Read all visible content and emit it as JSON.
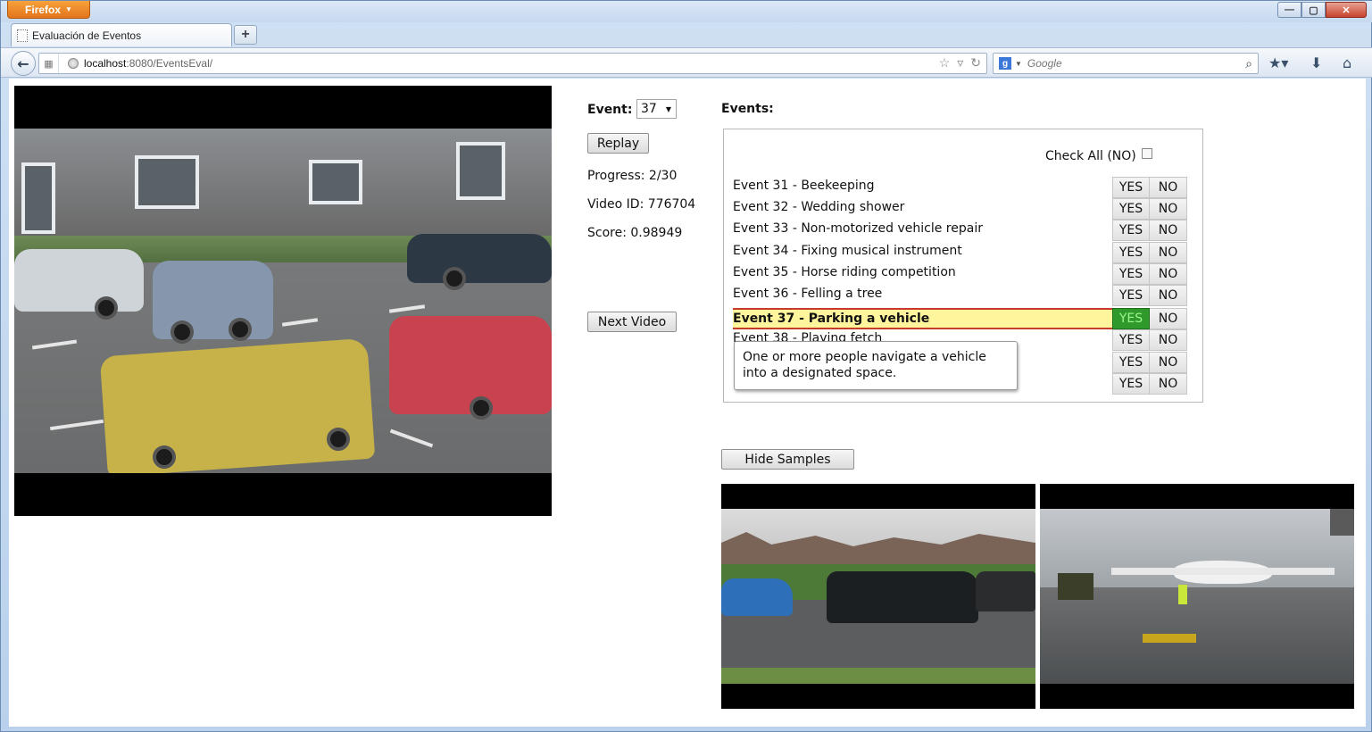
{
  "browser": {
    "menu_label": "Firefox",
    "tab_title": "Evaluación de Eventos",
    "url_host": "localhost",
    "url_rest": ":8080/EventsEval/",
    "search_placeholder": "Google",
    "window_controls": [
      "minimize-icon",
      "maximize-icon",
      "close-icon"
    ]
  },
  "controls": {
    "event_label": "Event:",
    "event_selected": "37",
    "replay_label": "Replay",
    "progress": "Progress: 2/30",
    "video_id": "Video ID: 776704",
    "score": "Score: 0.98949",
    "next_label": "Next Video",
    "hide_samples_label": "Hide Samples"
  },
  "events_panel": {
    "title": "Events:",
    "check_all_label": "Check All (NO)",
    "yes_label": "YES",
    "no_label": "NO",
    "items": [
      {
        "label": "Event 31 - Beekeeping",
        "selected": ""
      },
      {
        "label": "Event 32 - Wedding shower",
        "selected": ""
      },
      {
        "label": "Event 33 - Non-motorized vehicle repair",
        "selected": ""
      },
      {
        "label": "Event 34 - Fixing musical instrument",
        "selected": ""
      },
      {
        "label": "Event 35 - Horse riding competition",
        "selected": ""
      },
      {
        "label": "Event 36 - Felling a tree",
        "selected": ""
      },
      {
        "label": "Event 37 - Parking a vehicle",
        "selected": "YES"
      },
      {
        "label": "Event 38 - Playing fetch",
        "selected": ""
      },
      {
        "label": "",
        "selected": ""
      },
      {
        "label": "",
        "selected": ""
      }
    ],
    "tooltip": "One or more people navigate a vehicle into a designated space."
  },
  "colors": {
    "highlight": "#fff59d",
    "highlight_border": "#c63b2a",
    "yes_active": "#2f9a2b"
  }
}
